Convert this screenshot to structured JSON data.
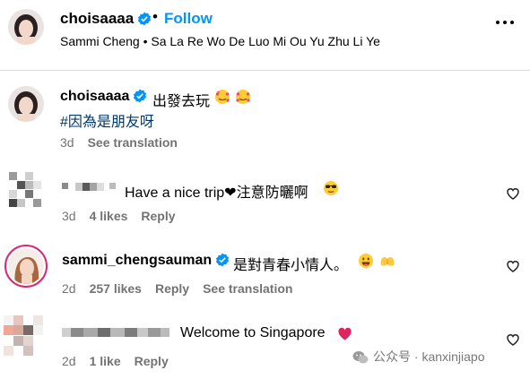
{
  "header": {
    "username": "choisaaaa",
    "separator": "•",
    "follow_label": "Follow",
    "subtitle": "Sammi Cheng • Sa La Re Wo De Luo Mi Ou Yu Zhu Li Ye"
  },
  "caption": {
    "username": "choisaaaa",
    "text": "出發去玩",
    "hashtag": "#因為是朋友呀",
    "time": "3d",
    "see_translation": "See translation"
  },
  "comments": [
    {
      "username": "",
      "text": "Have a nice trip❤注意防曬啊",
      "time": "3d",
      "likes": "4 likes",
      "reply": "Reply"
    },
    {
      "username": "sammi_chengsauman",
      "text": "是對青春小情人。",
      "time": "2d",
      "likes": "257 likes",
      "reply": "Reply",
      "see_translation": "See translation"
    },
    {
      "username": "",
      "text": "Welcome to Singapore",
      "time": "2d",
      "likes": "1 like",
      "reply": "Reply"
    }
  ],
  "watermark": "公众号 · kanxinjiapo",
  "colors": {
    "follow": "#0095f6",
    "verified": "#0095f6",
    "hashtag": "#00376b",
    "meta": "#737373",
    "heart_red": "#e0245e"
  },
  "icons": [
    "verified-badge-icon",
    "more-options-icon",
    "heart-icon",
    "emoji-icon"
  ]
}
